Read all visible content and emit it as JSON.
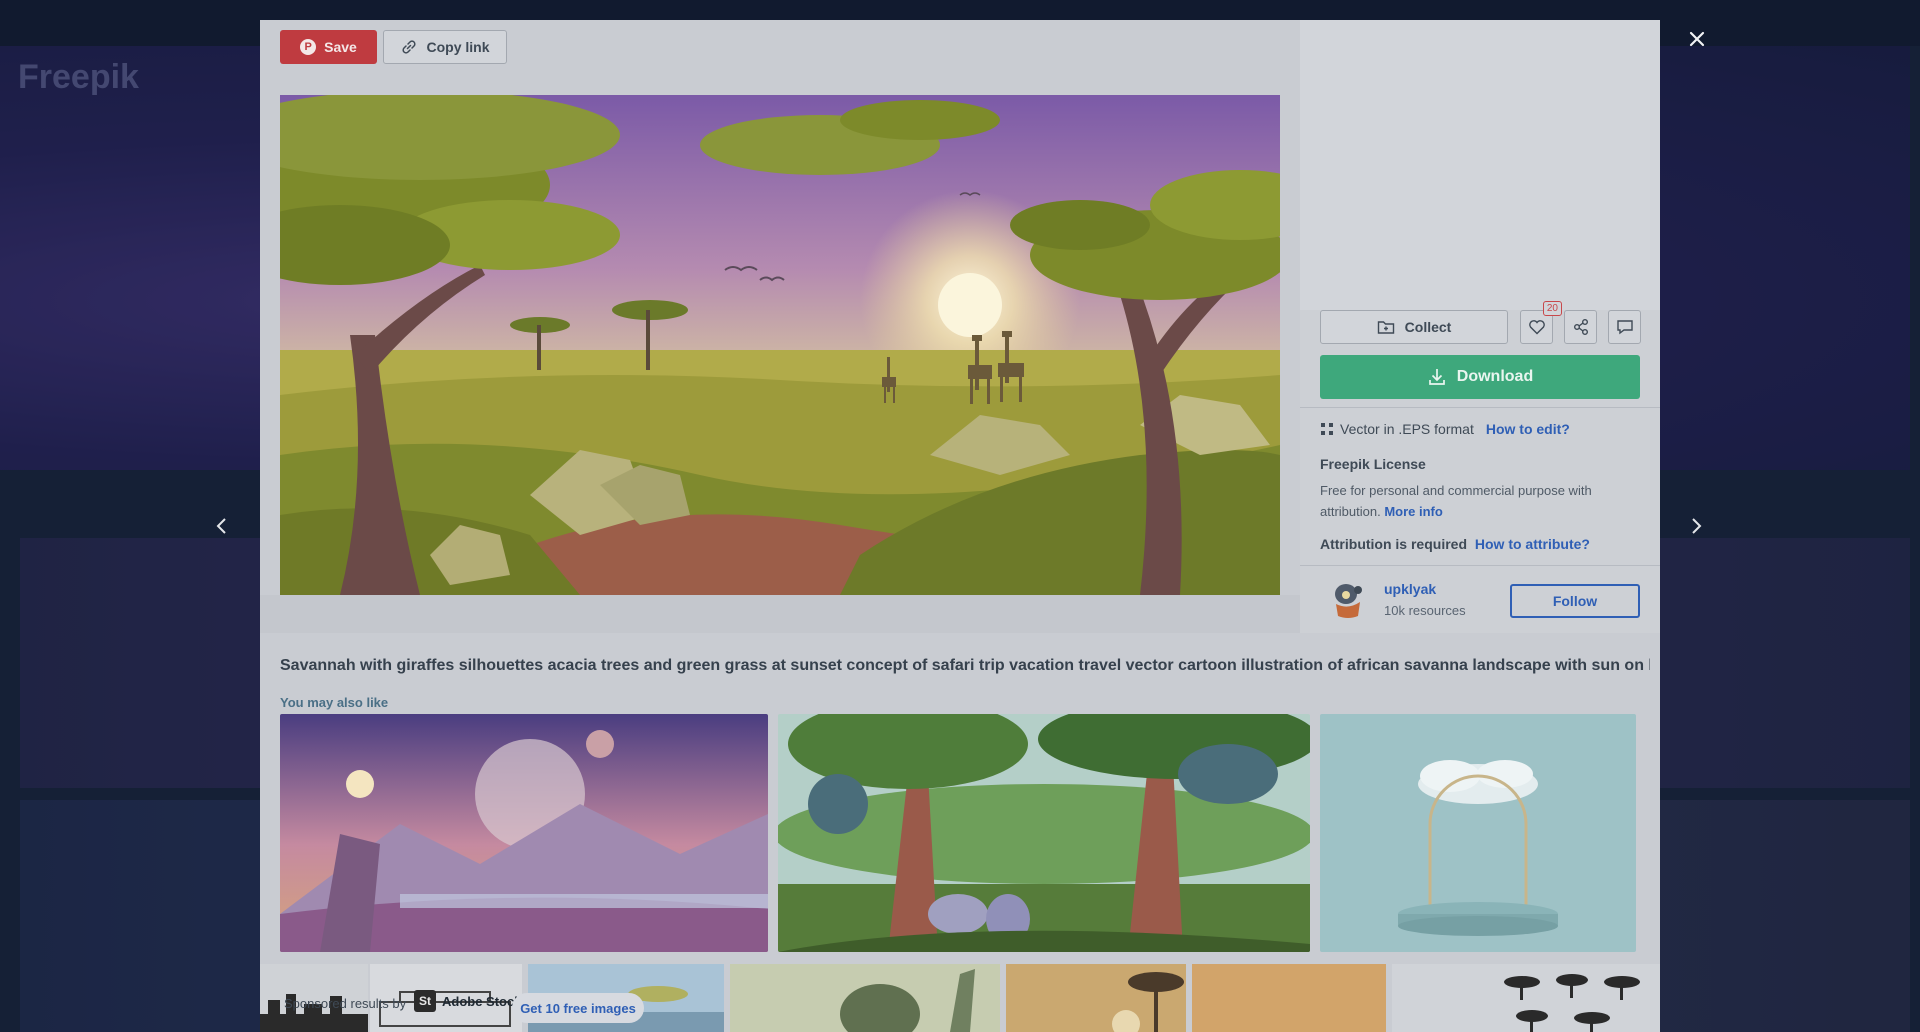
{
  "toolbar": {
    "save_label": "Save",
    "copy_label": "Copy link"
  },
  "actions": {
    "collect_label": "Collect",
    "like_count": "20",
    "download_label": "Download"
  },
  "format": {
    "text": "Vector in .EPS format",
    "link": "How to edit?"
  },
  "license": {
    "title": "Freepik License",
    "description": "Free for personal and commercial purpose with attribution.",
    "more_info": "More info",
    "attribution_text": "Attribution is required",
    "attribution_link": "How to attribute?"
  },
  "author": {
    "name": "upklyak",
    "resources": "10k resources",
    "follow_label": "Follow"
  },
  "resource": {
    "title": "Savannah with giraffes silhouettes acacia trees and green grass at sunset concept of safari trip vacation travel vector cartoon illustration of african savanna landscape with sun on horizon Fr..."
  },
  "related": {
    "heading": "You may also like",
    "items": [
      "alien-planet-sunset-thumbnail",
      "forest-cartoon-thumbnail",
      "cloud-podium-thumbnail"
    ]
  },
  "sponsored": {
    "label": "Sponsored results by",
    "provider": "Adobe Stock",
    "badge": "St",
    "cta": "Get 10 free images"
  },
  "background": {
    "logo": "Freepik"
  },
  "colors": {
    "save": "#bf3b40",
    "download": "#3ea87c",
    "link": "#2f5fb5"
  },
  "icons": [
    "pinterest-icon",
    "link-icon",
    "folder-plus-icon",
    "heart-icon",
    "share-icon",
    "comment-icon",
    "download-icon",
    "vector-format-icon",
    "close-icon",
    "chevron-left-icon",
    "chevron-right-icon"
  ]
}
